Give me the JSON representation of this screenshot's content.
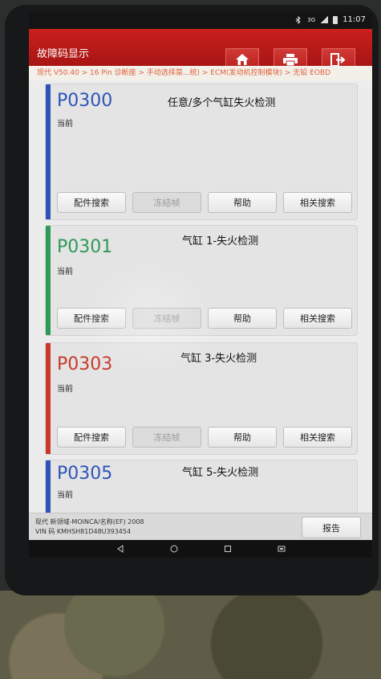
{
  "status_bar": {
    "time": "11:07",
    "network": "3G"
  },
  "header": {
    "title": "故障码显示"
  },
  "breadcrumb": "现代 V50.40 > 16 Pin 诊断座 > 手动选择菜...统) > ECM(发动机控制模块) > 无铅 EOBD",
  "dtcs": [
    {
      "code": "P0300",
      "status": "当前",
      "description": "任意/多个气缸失火检测",
      "color": "#2d55b8",
      "buttons": [
        "配件搜索",
        "冻结帧",
        "帮助",
        "相关搜索"
      ],
      "freeze_disabled": true
    },
    {
      "code": "P0301",
      "status": "当前",
      "description": "气缸 1-失火检测",
      "color": "#2f9a58",
      "buttons": [
        "配件搜索",
        "冻结帧",
        "帮助",
        "相关搜索"
      ],
      "freeze_disabled": true
    },
    {
      "code": "P0303",
      "status": "当前",
      "description": "气缸 3-失火检测",
      "color": "#c8392c",
      "buttons": [
        "配件搜索",
        "冻结帧",
        "帮助",
        "相关搜索"
      ],
      "freeze_disabled": true
    },
    {
      "code": "P0305",
      "status": "当前",
      "description": "气缸 5-失火检测",
      "color": "#2d55b8",
      "buttons": [],
      "freeze_disabled": true
    }
  ],
  "footer": {
    "vehicle": "现代 新领域-MOINCA/名称(EF) 2008",
    "vin": "VIN 码 KMHSH81D48U393454",
    "report_label": "报告"
  },
  "icons": {
    "home": "home-icon",
    "print": "print-icon",
    "exit": "exit-icon",
    "back": "back-icon",
    "nav_home": "circle-home-icon",
    "recents": "recents-icon",
    "screenshot": "screenshot-icon"
  }
}
